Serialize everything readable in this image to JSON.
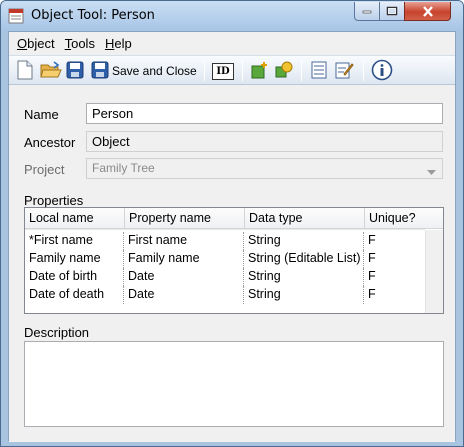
{
  "window": {
    "title": "Object Tool: Person"
  },
  "menu": [
    {
      "label": "Object",
      "key": "O"
    },
    {
      "label": "Tools",
      "key": "T"
    },
    {
      "label": "Help",
      "key": "H"
    }
  ],
  "toolbar": {
    "save_close_label": "Save and Close",
    "id_label": "ID",
    "icons": [
      "new-document-icon",
      "open-folder-icon",
      "save-icon",
      "save-and-close-icon",
      "id-icon",
      "add-shape-icon",
      "shapes-icon",
      "properties-form-icon",
      "edit-document-icon",
      "info-icon"
    ]
  },
  "form": {
    "name_label": "Name",
    "name_value": "Person",
    "ancestor_label": "Ancestor",
    "ancestor_value": "Object",
    "project_label": "Project",
    "project_value": "Family Tree"
  },
  "properties": {
    "title": "Properties",
    "columns": [
      "Local name",
      "Property name",
      "Data type",
      "Unique?"
    ],
    "rows": [
      [
        "*First name",
        "First name",
        "String",
        "F"
      ],
      [
        "Family name",
        "Family name",
        "String (Editable List)",
        "F"
      ],
      [
        "Date of birth",
        "Date",
        "String",
        "F"
      ],
      [
        "Date of death",
        "Date",
        "String",
        "F"
      ]
    ]
  },
  "description": {
    "title": "Description",
    "value": ""
  },
  "colors": {
    "title_bar": "#a7c5e6",
    "close_button": "#c7432c",
    "window_bg": "#f0f0f0"
  }
}
